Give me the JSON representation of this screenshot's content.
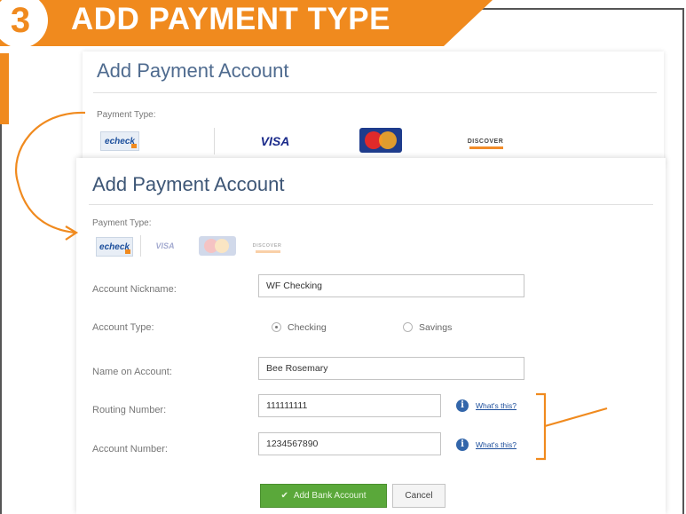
{
  "step": {
    "number": "3",
    "title": "ADD PAYMENT TYPE"
  },
  "back_panel": {
    "title": "Add Payment Account",
    "payment_type_label": "Payment Type:",
    "logos": {
      "ecard": "echeck",
      "visa": "VISA",
      "mastercard": "MasterCard",
      "discover": "DISCOVER"
    }
  },
  "form": {
    "title": "Add Payment Account",
    "payment_type_label": "Payment Type:",
    "logos": {
      "ecard": "echeck",
      "visa": "VISA",
      "mastercard": "MasterCard",
      "discover": "DISCOVER"
    },
    "selected_payment_type": "echeck",
    "account_nickname": {
      "label": "Account Nickname:",
      "value": "WF Checking"
    },
    "account_type": {
      "label": "Account Type:",
      "options": [
        "Checking",
        "Savings"
      ],
      "selected": "Checking"
    },
    "name_on_account": {
      "label": "Name on Account:",
      "value": "Bee Rosemary"
    },
    "routing_number": {
      "label": "Routing Number:",
      "value": "111111111",
      "help_link": "What's this?"
    },
    "account_number": {
      "label": "Account Number:",
      "value": "1234567890",
      "help_link": "What's this?"
    },
    "submit_button": {
      "icon": "✔",
      "label": "Add Bank Account"
    },
    "cancel_button": "Cancel"
  },
  "colors": {
    "accent_orange": "#f08a1e",
    "title_blue": "#4f6b8f",
    "link_blue": "#1e4f9c",
    "button_green": "#5aa83a"
  }
}
